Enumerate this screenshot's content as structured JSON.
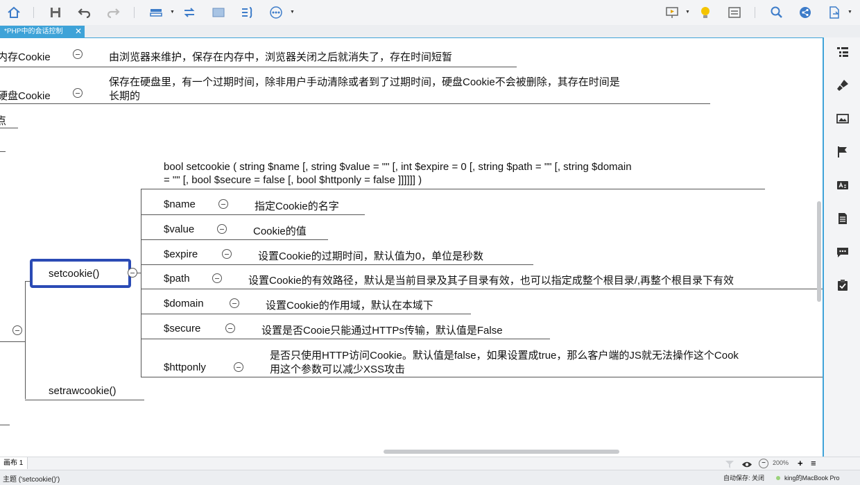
{
  "toolbar": {
    "icons": [
      "home-icon",
      "save-icon",
      "undo-icon",
      "redo-icon",
      "insert-topic-icon",
      "relationship-icon",
      "boundary-icon",
      "summary-icon",
      "more-icon",
      "present-icon",
      "idea-icon",
      "outline-icon",
      "search-icon",
      "share-icon",
      "export-icon"
    ]
  },
  "tab": {
    "title": "*PHP中的会话控制",
    "close": "✕"
  },
  "nodes": {
    "memory_cookie": "内存Cookie",
    "memory_cookie_desc": "由浏览器来维护，保存在内存中，浏览器关闭之后就消失了，存在时间短暂",
    "disk_cookie": "硬盘Cookie",
    "disk_cookie_desc_1": "保存在硬盘里，有一个过期时间，除非用户手动清除或者到了过期时间，硬盘Cookie不会被删除，其存在时间是",
    "disk_cookie_desc_2": "长期的",
    "clipped_char": "点",
    "signature_1": "bool setcookie ( string $name [, string $value = \"\" [, int $expire = 0 [, string $path = \"\" [, string $domain",
    "signature_2": "= \"\" [, bool $secure = false [, bool $httponly = false ]]]]]] )",
    "setcookie": "setcookie()",
    "setrawcookie": "setrawcookie()",
    "params": [
      {
        "name": "$name",
        "desc": "指定Cookie的名字"
      },
      {
        "name": "$value",
        "desc": "Cookie的值"
      },
      {
        "name": "$expire",
        "desc": "设置Cookie的过期时间，默认值为0，单位是秒数"
      },
      {
        "name": "$path",
        "desc": "设置Cookie的有效路径，默认是当前目录及其子目录有效，也可以指定成整个根目录/,再整个根目录下有效"
      },
      {
        "name": "$domain",
        "desc": "设置Cookie的作用域，默认在本域下"
      },
      {
        "name": "$secure",
        "desc": "设置是否Cooie只能通过HTTPs传输，默认值是False"
      },
      {
        "name": "$httponly",
        "desc_1": "是否只使用HTTP访问Cookie。默认值是false，如果设置成true，那么客户端的JS就无法操作这个Cook",
        "desc_2": "用这个参数可以减少XSS攻击"
      }
    ]
  },
  "sheet": {
    "tab": "画布 1",
    "zoom": "200%",
    "zoom_out": "−",
    "zoom_in": "+",
    "menu": "≡"
  },
  "status": {
    "topic": "主题 ('setcookie()')",
    "autosave": "自动保存: 关闭",
    "device": "king的MacBook Pro"
  },
  "colors": {
    "accent": "#3ea3d8",
    "selection": "#2b4bb5"
  }
}
